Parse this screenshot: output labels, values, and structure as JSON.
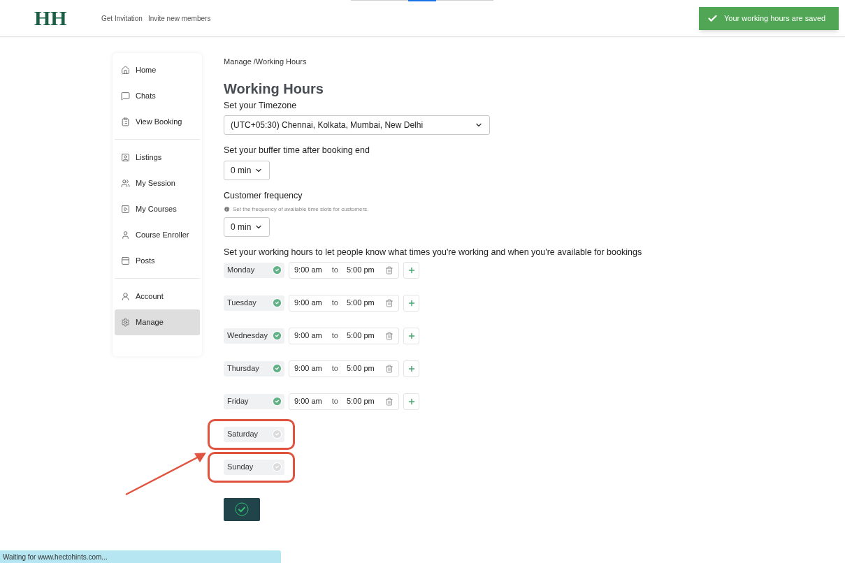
{
  "header": {
    "logo": "HH",
    "nav": [
      "Get Invitation",
      "Invite new members"
    ]
  },
  "toast": {
    "message": "Your working hours are saved"
  },
  "sidebar": {
    "groups": [
      [
        {
          "label": "Home",
          "selected": false
        },
        {
          "label": "Chats",
          "selected": false
        },
        {
          "label": "View Booking",
          "selected": false
        }
      ],
      [
        {
          "label": "Listings",
          "selected": false
        },
        {
          "label": "My Session",
          "selected": false
        },
        {
          "label": "My Courses",
          "selected": false
        },
        {
          "label": "Course Enroller",
          "selected": false
        },
        {
          "label": "Posts",
          "selected": false
        }
      ],
      [
        {
          "label": "Account",
          "selected": false
        },
        {
          "label": "Manage",
          "selected": true
        }
      ]
    ]
  },
  "breadcrumb": "Manage /Working Hours",
  "title": "Working Hours",
  "timezone": {
    "label": "Set your Timezone",
    "value": "(UTC+05:30) Chennai, Kolkata, Mumbai, New Delhi"
  },
  "buffer": {
    "label": "Set your buffer time after booking end",
    "value": "0 min"
  },
  "frequency": {
    "label": "Customer frequency",
    "hint": "Set the frequency of available time slots for customers.",
    "value": "0 min"
  },
  "hours": {
    "label": "Set your working hours to let people know what times you're working and when you're available for bookings",
    "days": [
      {
        "day": "Monday",
        "enabled": true,
        "highlighted": false,
        "from": "9:00 am",
        "separator": "to",
        "to": "5:00 pm"
      },
      {
        "day": "Tuesday",
        "enabled": true,
        "highlighted": false,
        "from": "9:00 am",
        "separator": "to",
        "to": "5:00 pm"
      },
      {
        "day": "Wednesday",
        "enabled": true,
        "highlighted": false,
        "from": "9:00 am",
        "separator": "to",
        "to": "5:00 pm"
      },
      {
        "day": "Thursday",
        "enabled": true,
        "highlighted": false,
        "from": "9:00 am",
        "separator": "to",
        "to": "5:00 pm"
      },
      {
        "day": "Friday",
        "enabled": true,
        "highlighted": false,
        "from": "9:00 am",
        "separator": "to",
        "to": "5:00 pm"
      },
      {
        "day": "Saturday",
        "enabled": false,
        "highlighted": true
      },
      {
        "day": "Sunday",
        "enabled": false,
        "highlighted": true
      }
    ]
  },
  "status_bar": "Waiting for www.hectohints.com..."
}
